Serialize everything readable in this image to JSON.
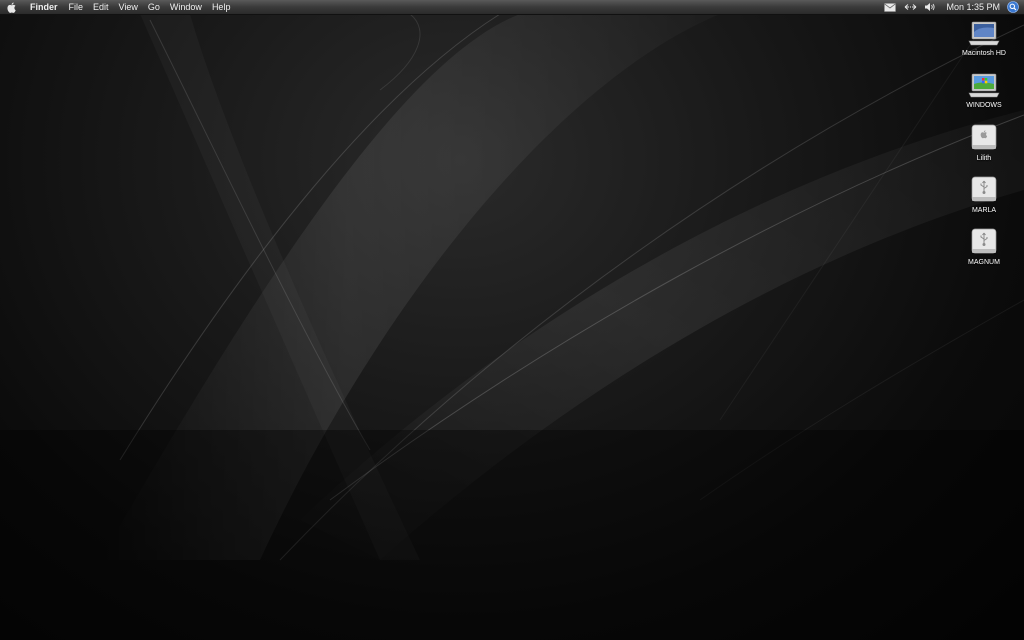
{
  "menubar": {
    "apple_icon": "apple-logo-icon",
    "app_name": "Finder",
    "menus": [
      "File",
      "Edit",
      "View",
      "Go",
      "Window",
      "Help"
    ],
    "status_icons": [
      "mail-icon",
      "network-arrows-icon",
      "volume-icon"
    ],
    "clock": "Mon 1:35 PM",
    "spotlight_icon": "spotlight-search-icon"
  },
  "desktop_icons": [
    {
      "label": "Macintosh HD",
      "icon": "laptop-drive-icon"
    },
    {
      "label": "WINDOWS",
      "icon": "laptop-windows-drive-icon"
    },
    {
      "label": "Lilith",
      "icon": "external-drive-apple-icon"
    },
    {
      "label": "MARLA",
      "icon": "usb-drive-icon"
    },
    {
      "label": "MAGNUM",
      "icon": "usb-drive-icon"
    }
  ],
  "colors": {
    "menubar": "#3a3a3a",
    "menubar_text": "#f0f0f0",
    "desktop": "#1a1a1a",
    "spotlight_accent": "#3a78d0"
  }
}
